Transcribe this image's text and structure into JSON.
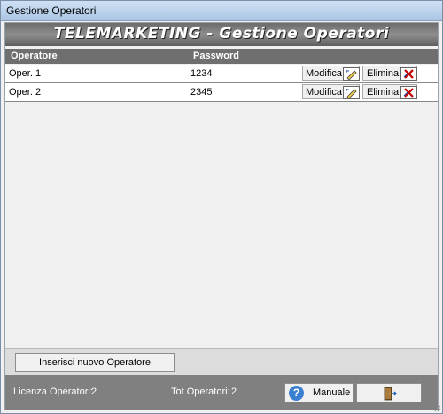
{
  "window": {
    "title": "Gestione Operatori"
  },
  "banner": {
    "text": "TELEMARKETING - Gestione Operatori"
  },
  "table": {
    "columns": [
      "Operatore",
      "Password"
    ],
    "rows": [
      {
        "operatore": "Oper. 1",
        "password": "1234",
        "edit_label": "Modifica",
        "delete_label": "Elimina"
      },
      {
        "operatore": "Oper. 2",
        "password": "2345",
        "edit_label": "Modifica",
        "delete_label": "Elimina"
      }
    ]
  },
  "actions": {
    "insert_label": "Inserisci nuovo Operatore"
  },
  "footer": {
    "license_label": "Licenza Operatori:",
    "license_value": "2",
    "total_label": "Tot Operatori:",
    "total_value": "2",
    "manual_label": "Manuale"
  },
  "icons": {
    "edit": "pencil-edit-icon",
    "delete": "delete-x-icon",
    "help": "help-question-icon",
    "exit": "exit-door-icon"
  },
  "colors": {
    "banner_bg": "#6c6c6c",
    "header_bg": "#6f6f6f",
    "footer_bg": "#808080",
    "delete_icon": "#c00000",
    "help_icon": "#3b7fd0"
  }
}
